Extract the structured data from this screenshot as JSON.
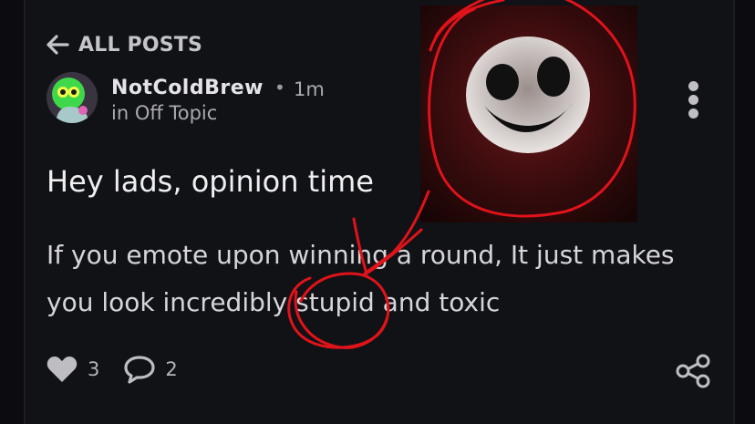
{
  "nav": {
    "back_label": "ALL POSTS"
  },
  "post": {
    "author": "NotColdBrew",
    "separator": "•",
    "time": "1m",
    "community": "in Off Topic",
    "title": "Hey lads, opinion time",
    "body_line1": "If you emote upon winning a round, It just makes",
    "body_line2_a": "you look incredibly ",
    "body_line2_b": "stupid",
    "body_line2_c": " and toxic"
  },
  "actions": {
    "likes": "3",
    "comments": "2"
  },
  "icons": [
    "arrow-left-icon",
    "avatar",
    "kebab-menu-icon",
    "heart-icon",
    "comment-icon",
    "share-icon"
  ],
  "colors": {
    "background": "#111216",
    "annotation_red": "#e0131a"
  }
}
